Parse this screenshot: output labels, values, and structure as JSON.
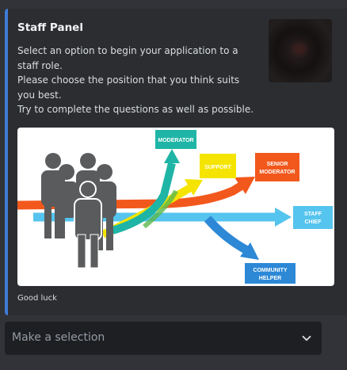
{
  "embed": {
    "title": "Staff Panel",
    "description": "Select an option to begin your application to a staff role.\nPlease choose the position that you think suits you best.\nTry to complete the questions as well as possible.",
    "footer": "Good luck",
    "accent_color": "#3e7bd6",
    "image": {
      "labels": {
        "moderator": "MODERATOR",
        "support": "SUPPORT",
        "senior_moderator_line1": "SENIOR",
        "senior_moderator_line2": "MODERATOR",
        "staff_chief_line1": "STAFF",
        "staff_chief_line2": "CHIEF",
        "community_helper_line1": "COMMUNITY",
        "community_helper_line2": "HELPER"
      },
      "colors": {
        "moderator": "#1fb5a6",
        "support": "#f4e400",
        "senior_moderator": "#f2581c",
        "staff_chief": "#55c4ee",
        "community_helper": "#2d88d6",
        "people": "#5a5b5d"
      }
    }
  },
  "select": {
    "placeholder": "Make a selection",
    "icon": "chevron-down-icon"
  }
}
